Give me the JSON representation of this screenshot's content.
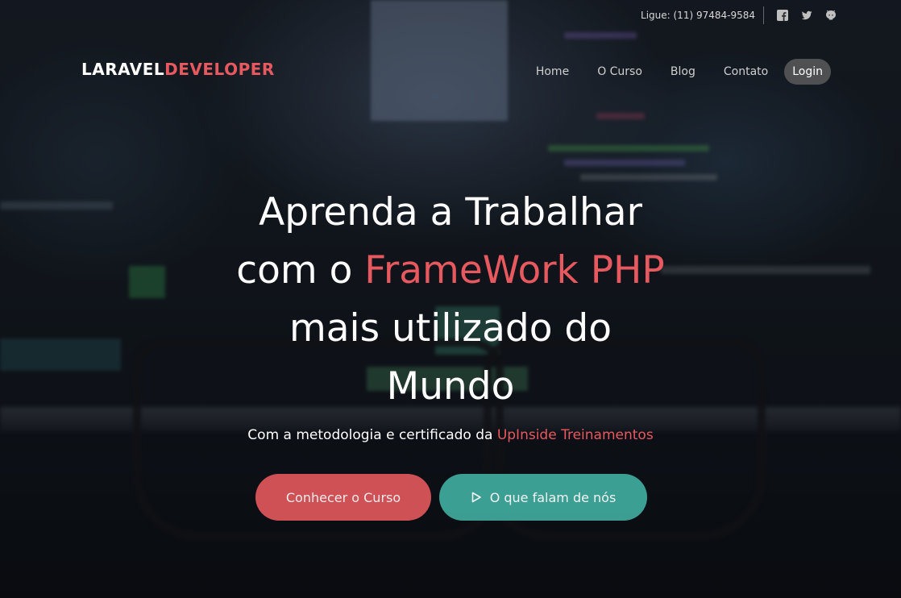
{
  "topbar": {
    "phone": "Ligue: (11) 97484-9584",
    "social": [
      "facebook-icon",
      "twitter-icon",
      "github-icon"
    ]
  },
  "logo": {
    "part1": "LARAVEL",
    "part2": "DEVELOPER"
  },
  "nav": {
    "items": [
      {
        "label": "Home"
      },
      {
        "label": "O Curso"
      },
      {
        "label": "Blog"
      },
      {
        "label": "Contato"
      }
    ],
    "login": "Login"
  },
  "hero": {
    "line1": "Aprenda a Trabalhar",
    "line2_pre": "com o ",
    "line2_accent": "FrameWork PHP",
    "line3": "mais utilizado do",
    "line4": "Mundo",
    "sub_pre": "Com a metodologia e certificado da ",
    "sub_accent": "UpInside Treinamentos"
  },
  "buttons": {
    "course": "Conhecer o Curso",
    "talk": "O que falam de nós"
  },
  "colors": {
    "accent": "#e8595f",
    "teal": "#3fa79a",
    "coral_button": "#e0575c"
  }
}
